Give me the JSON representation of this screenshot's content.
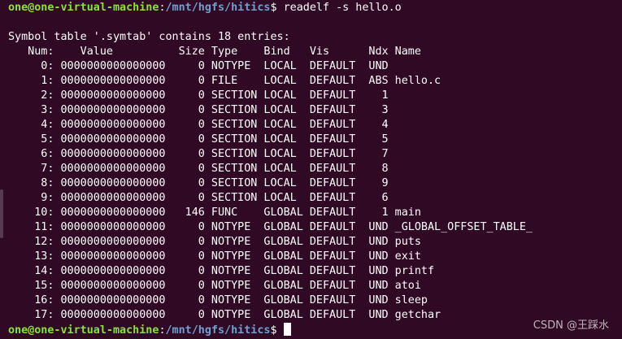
{
  "prompt": {
    "user_host": "one@one-virtual-machine",
    "separator": ":",
    "path": "/mnt/hgfs/hitics",
    "symbol": "$ "
  },
  "command": "readelf -s hello.o",
  "blank": "",
  "header_line": "Symbol table '.symtab' contains 18 entries:",
  "columns_line": "   Num:    Value          Size Type    Bind   Vis      Ndx Name",
  "rows": [
    "     0: 0000000000000000     0 NOTYPE  LOCAL  DEFAULT  UND ",
    "     1: 0000000000000000     0 FILE    LOCAL  DEFAULT  ABS hello.c",
    "     2: 0000000000000000     0 SECTION LOCAL  DEFAULT    1 ",
    "     3: 0000000000000000     0 SECTION LOCAL  DEFAULT    3 ",
    "     4: 0000000000000000     0 SECTION LOCAL  DEFAULT    4 ",
    "     5: 0000000000000000     0 SECTION LOCAL  DEFAULT    5 ",
    "     6: 0000000000000000     0 SECTION LOCAL  DEFAULT    7 ",
    "     7: 0000000000000000     0 SECTION LOCAL  DEFAULT    8 ",
    "     8: 0000000000000000     0 SECTION LOCAL  DEFAULT    9 ",
    "     9: 0000000000000000     0 SECTION LOCAL  DEFAULT    6 ",
    "    10: 0000000000000000   146 FUNC    GLOBAL DEFAULT    1 main",
    "    11: 0000000000000000     0 NOTYPE  GLOBAL DEFAULT  UND _GLOBAL_OFFSET_TABLE_",
    "    12: 0000000000000000     0 NOTYPE  GLOBAL DEFAULT  UND puts",
    "    13: 0000000000000000     0 NOTYPE  GLOBAL DEFAULT  UND exit",
    "    14: 0000000000000000     0 NOTYPE  GLOBAL DEFAULT  UND printf",
    "    15: 0000000000000000     0 NOTYPE  GLOBAL DEFAULT  UND atoi",
    "    16: 0000000000000000     0 NOTYPE  GLOBAL DEFAULT  UND sleep",
    "    17: 0000000000000000     0 NOTYPE  GLOBAL DEFAULT  UND getchar"
  ],
  "watermark": "CSDN @王踩水",
  "colors": {
    "background": "#300a24",
    "prompt_user": "#8ae234",
    "prompt_path": "#729fcf",
    "text": "#ffffff"
  }
}
